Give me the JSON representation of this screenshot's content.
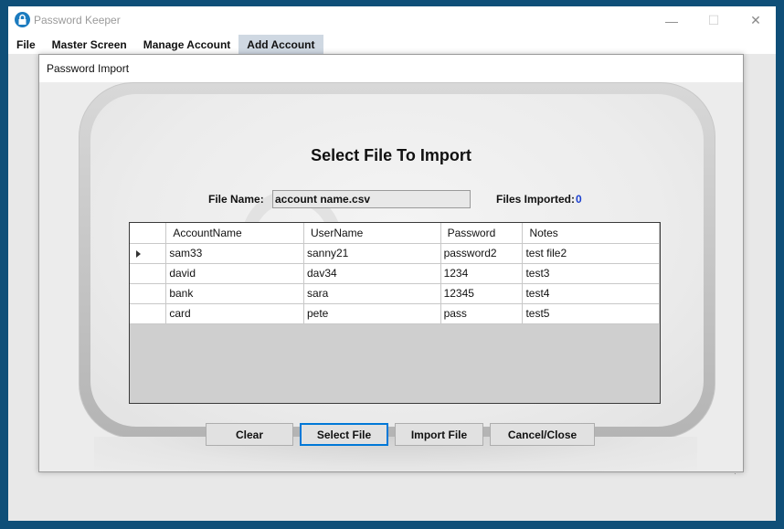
{
  "window": {
    "title": "Password Keeper",
    "minimize": "—",
    "maximize": "☐",
    "close": "✕"
  },
  "menu": {
    "items": [
      "File",
      "Master Screen",
      "Manage Account",
      "Add Account"
    ],
    "active": "Add Account"
  },
  "dialog": {
    "title": "Password Import",
    "heading": "Select File To Import",
    "file_name_label": "File Name:",
    "file_name_value": "account name.csv",
    "files_imported_label": "Files Imported:",
    "files_imported_value": "0"
  },
  "grid": {
    "columns": [
      "AccountName",
      "UserName",
      "Password",
      "Notes"
    ],
    "rows": [
      [
        "sam33",
        "sanny21",
        "password2",
        "test file2"
      ],
      [
        "david",
        "dav34",
        "1234",
        "test3"
      ],
      [
        "bank",
        "sara",
        "12345",
        "test4"
      ],
      [
        "card",
        "pete",
        "pass",
        "test5"
      ]
    ],
    "current_row": 0
  },
  "buttons": {
    "clear": "Clear",
    "select_file": "Select File",
    "import_file": "Import File",
    "cancel_close": "Cancel/Close"
  },
  "colors": {
    "desktop": "#0f4f78",
    "count_text": "#1a3fd0",
    "focus_border": "#0078d7"
  }
}
